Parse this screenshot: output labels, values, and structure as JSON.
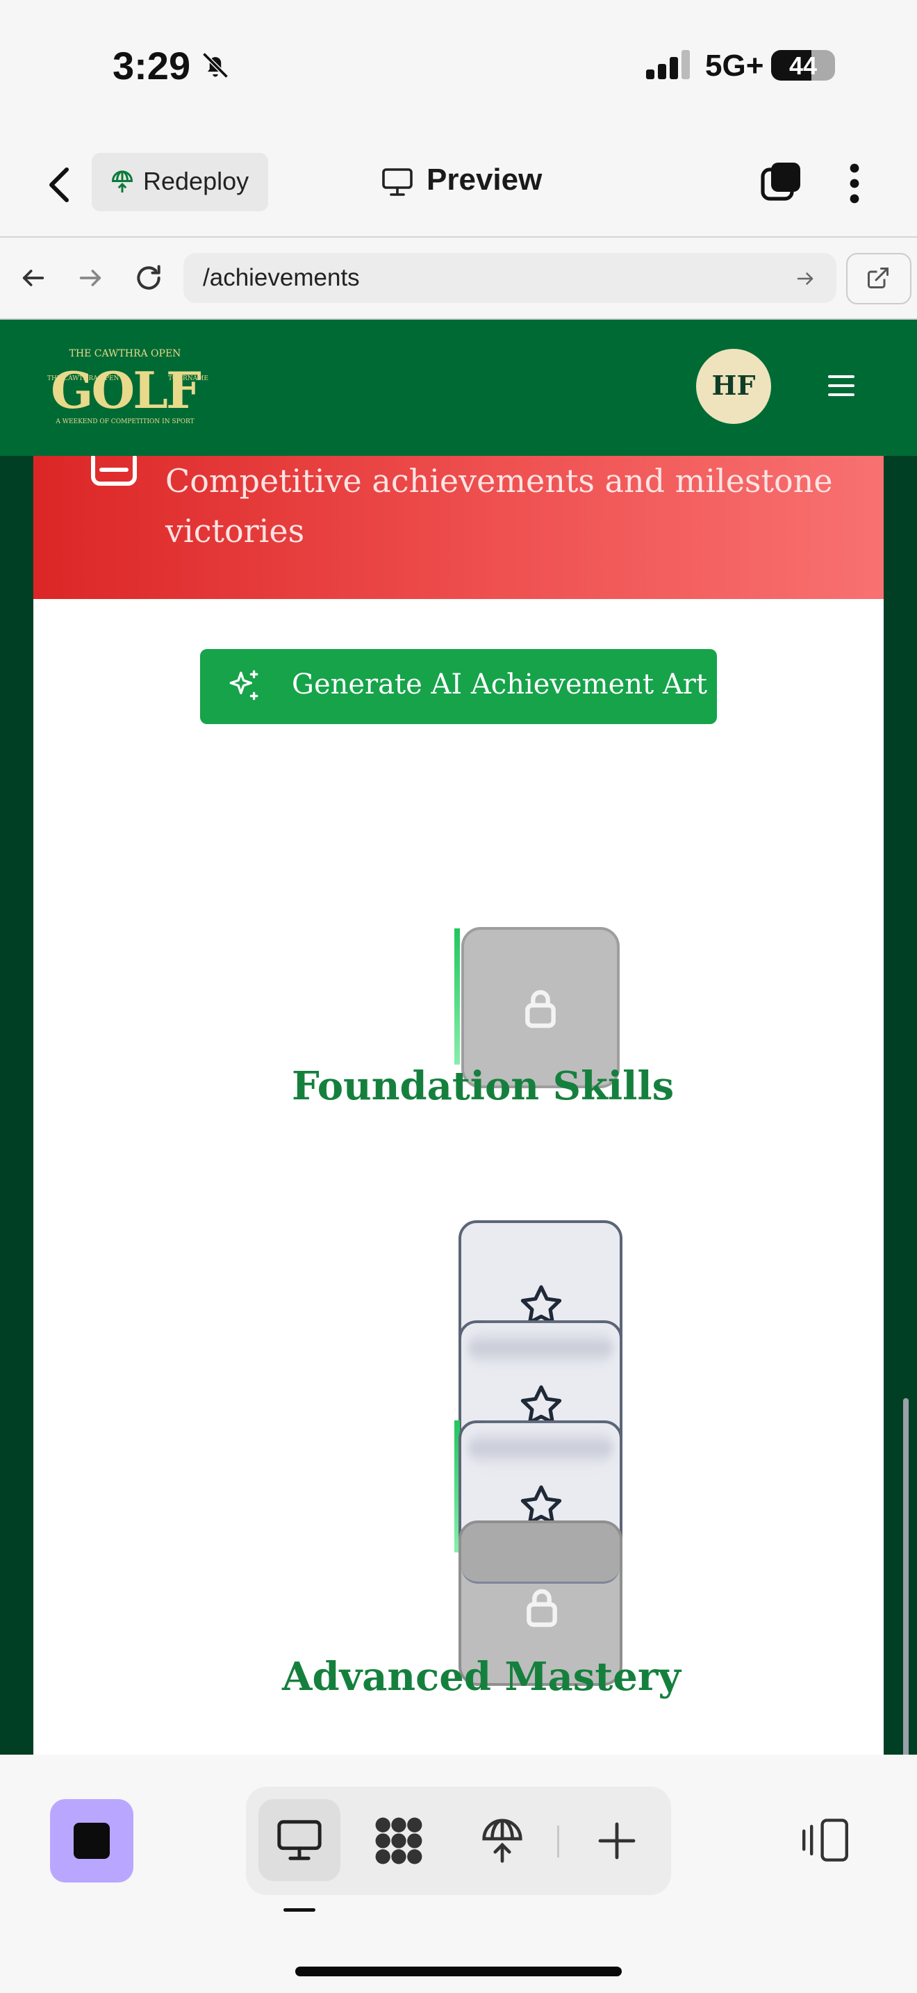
{
  "status_bar": {
    "time": "3:29",
    "network": "5G+",
    "battery": "44"
  },
  "app_nav": {
    "redeploy_label": "Redeploy",
    "preview_label": "Preview"
  },
  "browser": {
    "url": "/achievements"
  },
  "site": {
    "logo_text": {
      "top": "THE CAWTHRA OPEN",
      "main": "GOLF",
      "left": "THE CAWTHRA OPEN",
      "right": "TOURNAMENT EVENT",
      "bottom": "A WEEKEND OF COMPETITION IN SPORT"
    },
    "avatar_initials": "HF"
  },
  "banner": {
    "text": "Competitive achievements and milestone victories"
  },
  "ai_button": {
    "label": "Generate AI Achievement Art"
  },
  "sections": [
    {
      "title": "Foundation Skills"
    },
    {
      "title": "Advanced Mastery"
    }
  ],
  "colors": {
    "header_green": "#006a35",
    "page_dark_green": "#003f24",
    "banner_red": "#dc2626",
    "button_green": "#16a34a",
    "title_green": "#15803d",
    "avatar_cream": "#efe3bd",
    "stop_button_purple": "#b9a7ff"
  },
  "icons": {
    "status": [
      "bell-slash-icon",
      "signal-bars-icon",
      "battery-icon"
    ],
    "app_nav": [
      "back-chevron-icon",
      "redeploy-globe-icon",
      "monitor-icon",
      "tabs-icon",
      "more-vertical-icon"
    ],
    "browser": [
      "back-arrow-icon",
      "forward-arrow-icon",
      "reload-icon",
      "go-arrow-icon",
      "open-external-icon"
    ],
    "site": [
      "menu-icon",
      "trophy-icon",
      "sparkles-icon",
      "lock-icon",
      "star-icon"
    ],
    "toolbar": [
      "stop-icon",
      "desktop-icon",
      "apps-icon",
      "deploy-icon",
      "add-icon",
      "device-frame-icon"
    ]
  }
}
